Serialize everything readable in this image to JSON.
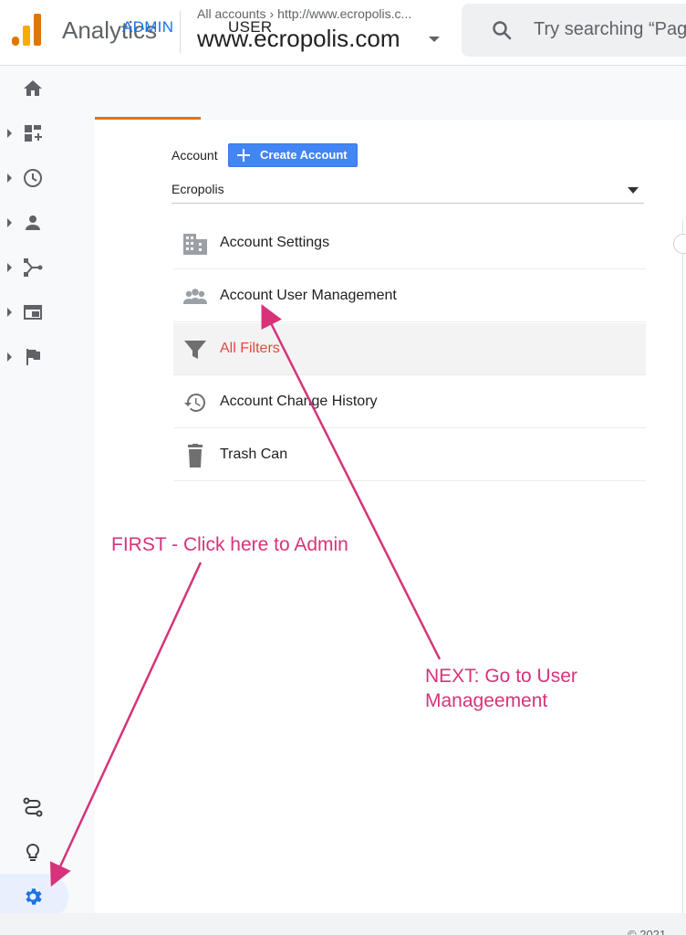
{
  "header": {
    "product_name": "Analytics",
    "account_crumb": "All accounts",
    "crumb_separator": "›",
    "property_url": "http://www.ecropolis.c...",
    "property_name": "www.ecropolis.com",
    "search_placeholder": "Try searching “Pag"
  },
  "left_nav": {
    "items": [
      {
        "name": "home",
        "icon": "home-icon"
      },
      {
        "name": "customization",
        "icon": "dashboard-icon"
      },
      {
        "name": "realtime",
        "icon": "clock-icon"
      },
      {
        "name": "audience",
        "icon": "person-icon"
      },
      {
        "name": "acquisition",
        "icon": "acquisition-icon"
      },
      {
        "name": "behavior",
        "icon": "behavior-icon"
      },
      {
        "name": "conversions",
        "icon": "flag-icon"
      }
    ],
    "bottom_items": [
      {
        "name": "attribution",
        "icon": "route-icon"
      },
      {
        "name": "discover",
        "icon": "lightbulb-icon"
      },
      {
        "name": "admin",
        "icon": "gear-icon"
      }
    ]
  },
  "tabs": [
    {
      "label": "ADMIN",
      "active": true
    },
    {
      "label": "USER",
      "active": false
    }
  ],
  "account_section": {
    "label": "Account",
    "create_button": "Create Account",
    "selected_account": "Ecropolis"
  },
  "menu": [
    {
      "label": "Account Settings",
      "icon": "building-icon"
    },
    {
      "label": "Account User Management",
      "icon": "people-icon"
    },
    {
      "label": "All Filters",
      "icon": "filter-icon",
      "active": true
    },
    {
      "label": "Account Change History",
      "icon": "history-icon"
    },
    {
      "label": "Trash Can",
      "icon": "trash-icon"
    }
  ],
  "annotations": {
    "first": "FIRST - Click here to Admin",
    "next_line1": "NEXT:  Go to User",
    "next_line2": "Manageement"
  },
  "footer": {
    "text": "© 2021"
  },
  "colors": {
    "accent_blue": "#1a73e8",
    "tab_underline": "#e37400",
    "active_filter": "#e8453c",
    "annotation": "#d6337a",
    "button_blue": "#4285f4"
  }
}
